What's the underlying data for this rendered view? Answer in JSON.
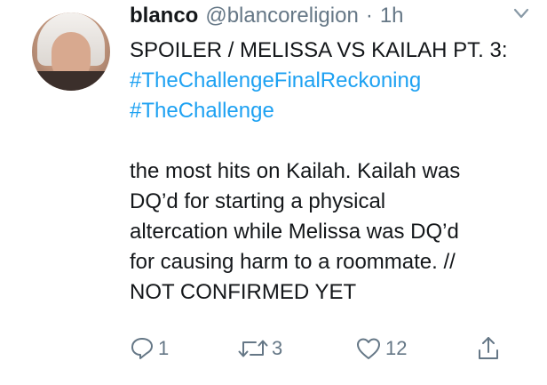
{
  "tweet": {
    "name": "blanco",
    "handle": "@blancoreligion",
    "separator": "·",
    "time": "1h",
    "line1": "SPOILER / MELISSA VS KAILAH PT. 3:",
    "hashtag1": "#TheChallengeFinalReckoning",
    "hashtag2": "#TheChallenge",
    "body_lines": [
      "the most hits on Kailah. Kailah was",
      "DQ’d for starting a physical",
      "altercation while Melissa was DQ’d",
      "for causing harm to a roommate. //",
      "NOT CONFIRMED YET"
    ]
  },
  "actions": {
    "reply_count": "1",
    "retweet_count": "3",
    "like_count": "12"
  },
  "icons": {
    "reply": "reply-icon",
    "retweet": "retweet-icon",
    "like": "heart-icon",
    "share": "share-icon",
    "menu": "chevron-down-icon"
  },
  "colors": {
    "hashtag": "#1da1f2",
    "secondary_text": "#657786"
  }
}
